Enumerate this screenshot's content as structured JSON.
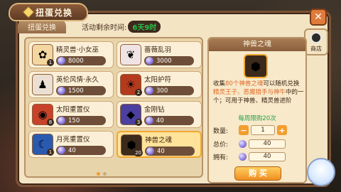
{
  "title": "扭蛋兑换",
  "subtab": "扭蛋兑换",
  "timer": {
    "label": "活动剩余时间:",
    "value": "6天9时"
  },
  "items": [
    {
      "name": "精灵兽·小女巫",
      "price": "8000",
      "badge": "1",
      "icon": "witch-icon",
      "bg": "#f4d6a0"
    },
    {
      "name": "蔷薇乱羽",
      "price": "3000",
      "badge": "",
      "icon": "feather-wings-icon",
      "bg": "#f0e3e3"
    },
    {
      "name": "英伦风情·永久",
      "price": "1500",
      "badge": "",
      "icon": "costume-icon",
      "bg": "#eadfd2"
    },
    {
      "name": "太阳护符",
      "price": "300",
      "badge": "2",
      "icon": "sun-amulet-icon",
      "bg": "#b43a1e"
    },
    {
      "name": "太阳重置仪",
      "price": "150",
      "badge": "8",
      "icon": "sun-reset-icon",
      "bg": "#c8432a"
    },
    {
      "name": "金刚钻",
      "price": "40",
      "badge": "3",
      "icon": "diamond-drill-icon",
      "bg": "#4b3fa0"
    },
    {
      "name": "月亮重置仪",
      "price": "40",
      "badge": "1",
      "icon": "moon-reset-icon",
      "bg": "#2a5ab0"
    },
    {
      "name": "神兽之魂",
      "price": "40",
      "badge": "20",
      "icon": "beast-soul-icon",
      "bg": "#3b2a1c",
      "selected": true
    }
  ],
  "detail": {
    "header": "神兽之魂",
    "desc_prefix": "收集",
    "desc_count": "80个神兽之魂",
    "desc_mid": "可以随机兑换",
    "desc_names": "精灵王子、恶魔猎手与神牛",
    "desc_suffix": "中的一个；可用于神兽、精灵兽进阶",
    "limit": "每周限购20次",
    "qty_label": "数量:",
    "qty_value": "1",
    "cost_label": "总价:",
    "cost_value": "40",
    "own_label": "拥有:",
    "own_value": "40",
    "buy_label": "购 买"
  },
  "shop_tab": "商店",
  "colors": {
    "accent": "#f29d2e",
    "green": "#26c04a",
    "frame": "#7b5234"
  }
}
